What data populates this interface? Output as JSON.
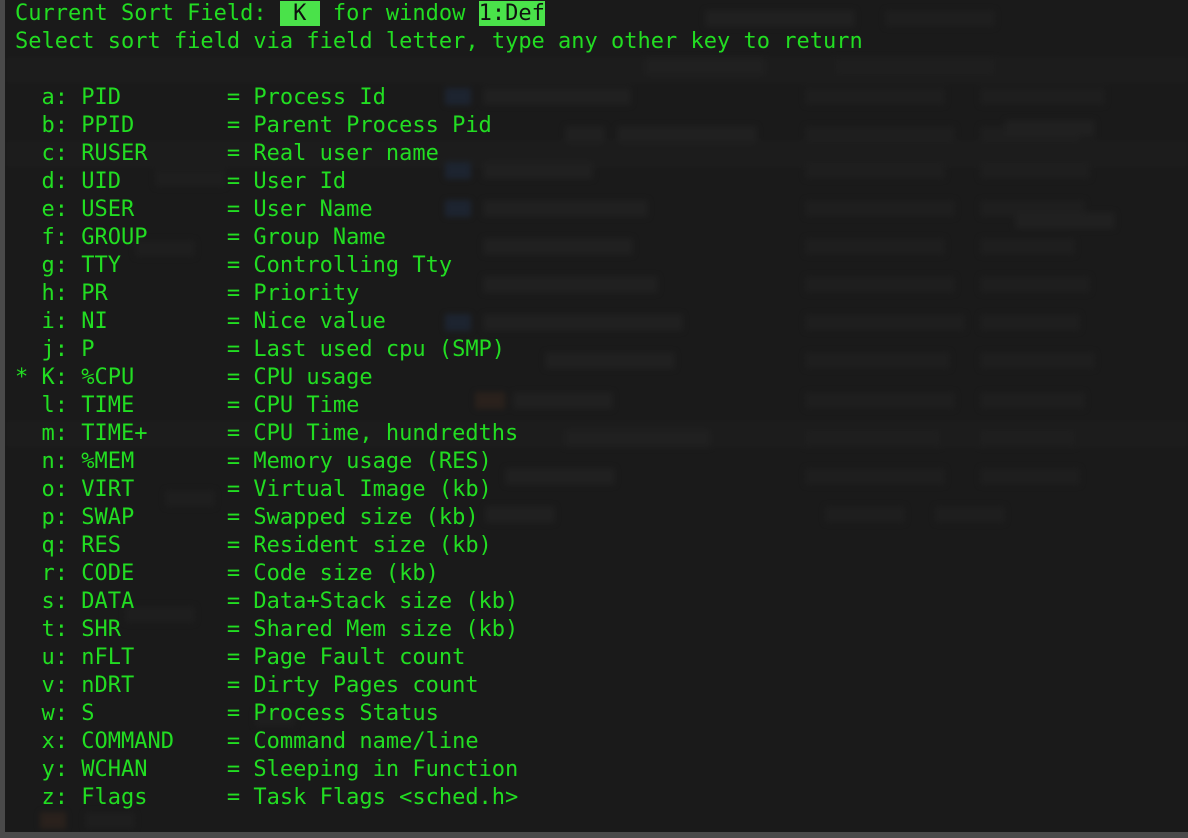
{
  "terminal": {
    "colors": {
      "background": "#1a1a1a",
      "foreground": "#22dd22",
      "highlight_bg": "#4ae24a",
      "highlight_fg": "#101010",
      "border": "#4a4a4a"
    }
  },
  "header": {
    "line1_prefix": "Current Sort Field:",
    "sort_field_key": " K ",
    "line1_middle": " for window ",
    "window_label": "1:Def",
    "line2": "Select sort field via field letter, type any other key to return"
  },
  "fields": [
    {
      "mark": "",
      "key": "a:",
      "field": "PID",
      "eq": "=",
      "desc": "Process Id"
    },
    {
      "mark": "",
      "key": "b:",
      "field": "PPID",
      "eq": "=",
      "desc": "Parent Process Pid"
    },
    {
      "mark": "",
      "key": "c:",
      "field": "RUSER",
      "eq": "=",
      "desc": "Real user name"
    },
    {
      "mark": "",
      "key": "d:",
      "field": "UID",
      "eq": "=",
      "desc": "User Id"
    },
    {
      "mark": "",
      "key": "e:",
      "field": "USER",
      "eq": "=",
      "desc": "User Name"
    },
    {
      "mark": "",
      "key": "f:",
      "field": "GROUP",
      "eq": "=",
      "desc": "Group Name"
    },
    {
      "mark": "",
      "key": "g:",
      "field": "TTY",
      "eq": "=",
      "desc": "Controlling Tty"
    },
    {
      "mark": "",
      "key": "h:",
      "field": "PR",
      "eq": "=",
      "desc": "Priority"
    },
    {
      "mark": "",
      "key": "i:",
      "field": "NI",
      "eq": "=",
      "desc": "Nice value"
    },
    {
      "mark": "",
      "key": "j:",
      "field": "P",
      "eq": "=",
      "desc": "Last used cpu (SMP)"
    },
    {
      "mark": "*",
      "key": "K:",
      "field": "%CPU",
      "eq": "=",
      "desc": "CPU usage"
    },
    {
      "mark": "",
      "key": "l:",
      "field": "TIME",
      "eq": "=",
      "desc": "CPU Time"
    },
    {
      "mark": "",
      "key": "m:",
      "field": "TIME+",
      "eq": "=",
      "desc": "CPU Time, hundredths"
    },
    {
      "mark": "",
      "key": "n:",
      "field": "%MEM",
      "eq": "=",
      "desc": "Memory usage (RES)"
    },
    {
      "mark": "",
      "key": "o:",
      "field": "VIRT",
      "eq": "=",
      "desc": "Virtual Image (kb)"
    },
    {
      "mark": "",
      "key": "p:",
      "field": "SWAP",
      "eq": "=",
      "desc": "Swapped size (kb)"
    },
    {
      "mark": "",
      "key": "q:",
      "field": "RES",
      "eq": "=",
      "desc": "Resident size (kb)"
    },
    {
      "mark": "",
      "key": "r:",
      "field": "CODE",
      "eq": "=",
      "desc": "Code size (kb)"
    },
    {
      "mark": "",
      "key": "s:",
      "field": "DATA",
      "eq": "=",
      "desc": "Data+Stack size (kb)"
    },
    {
      "mark": "",
      "key": "t:",
      "field": "SHR",
      "eq": "=",
      "desc": "Shared Mem size (kb)"
    },
    {
      "mark": "",
      "key": "u:",
      "field": "nFLT",
      "eq": "=",
      "desc": "Page Fault count"
    },
    {
      "mark": "",
      "key": "v:",
      "field": "nDRT",
      "eq": "=",
      "desc": "Dirty Pages count"
    },
    {
      "mark": "",
      "key": "w:",
      "field": "S",
      "eq": "=",
      "desc": "Process Status"
    },
    {
      "mark": "",
      "key": "x:",
      "field": "COMMAND",
      "eq": "=",
      "desc": "Command name/line"
    },
    {
      "mark": "",
      "key": "y:",
      "field": "WCHAN",
      "eq": "=",
      "desc": "Sleeping in Function"
    },
    {
      "mark": "",
      "key": "z:",
      "field": "Flags",
      "eq": "=",
      "desc": "Task Flags <sched.h>"
    }
  ]
}
